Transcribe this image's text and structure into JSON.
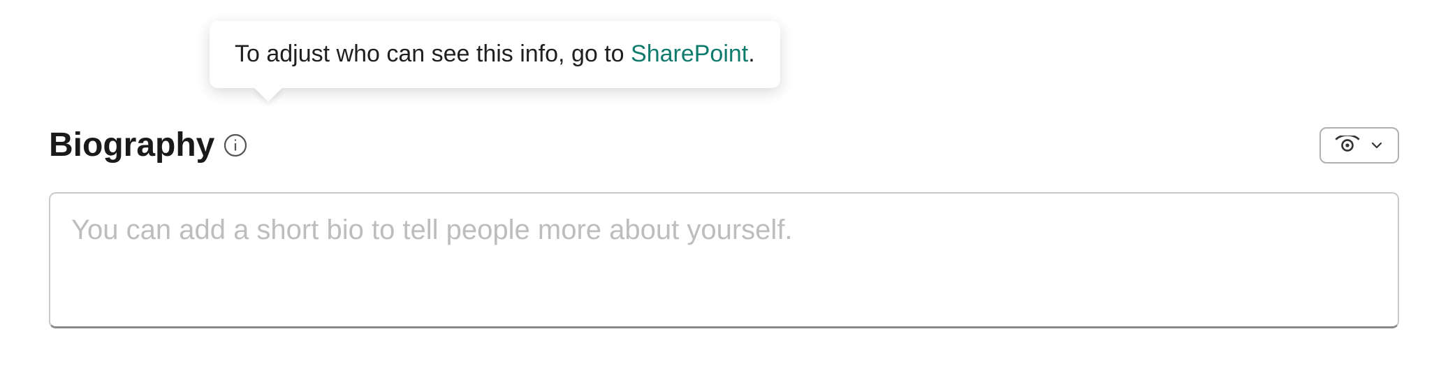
{
  "section": {
    "title": "Biography"
  },
  "tooltip": {
    "text_prefix": "To adjust who can see this info, go to ",
    "link_text": "SharePoint",
    "text_suffix": "."
  },
  "bio": {
    "placeholder": "You can add a short bio to tell people more about yourself.",
    "value": ""
  }
}
